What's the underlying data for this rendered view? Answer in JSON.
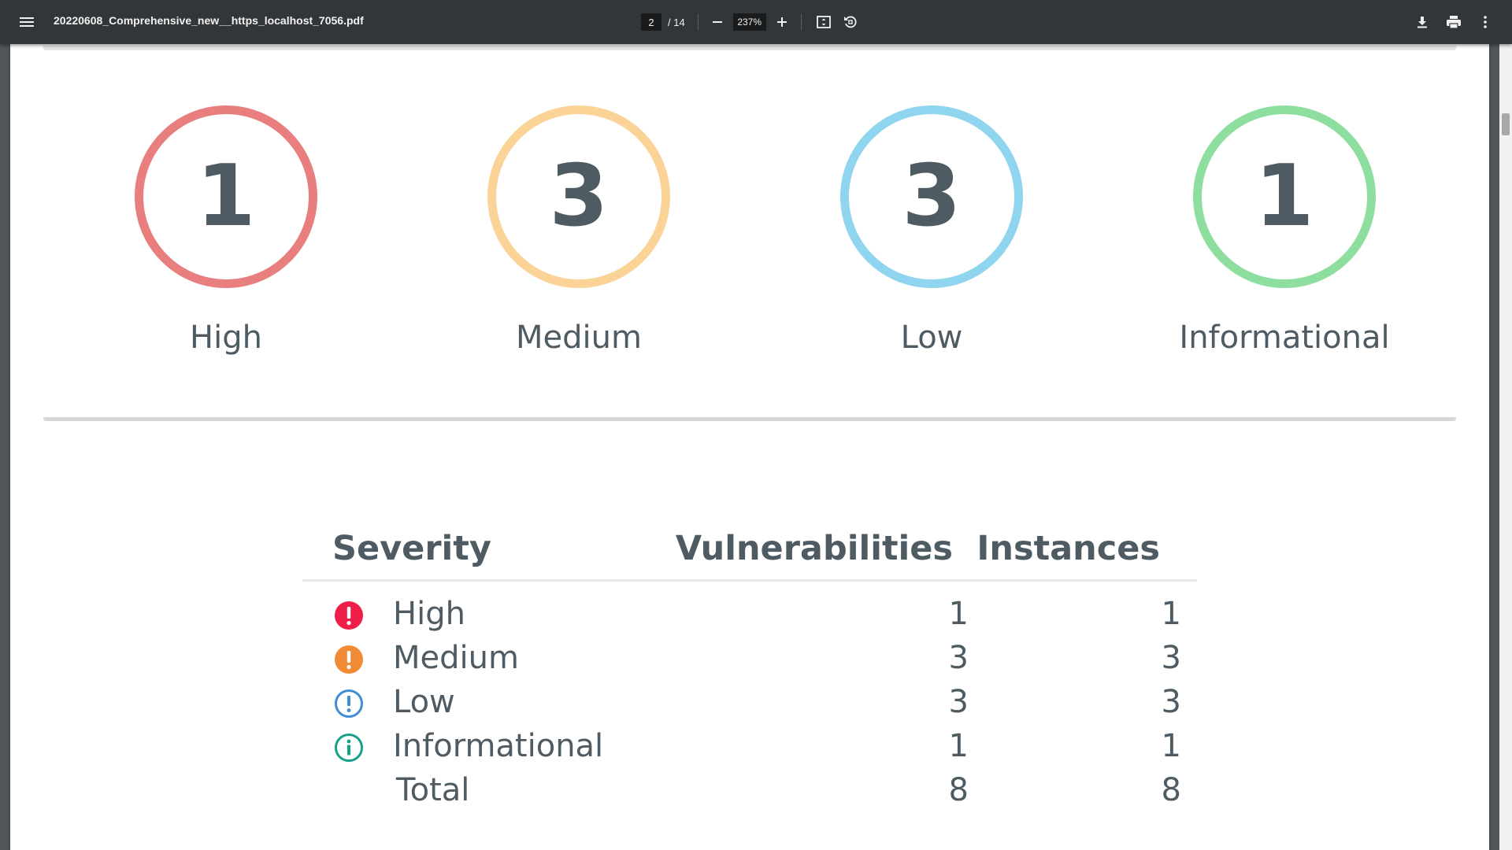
{
  "toolbar": {
    "filename": "20220608_Comprehensive_new__https_localhost_7056.pdf",
    "current_page": "2",
    "total_pages": "/ 14",
    "zoom": "237%",
    "icons": [
      "menu-icon",
      "zoom-out-icon",
      "zoom-in-icon",
      "fit-page-icon",
      "rotate-icon",
      "download-icon",
      "print-icon",
      "more-vert-icon"
    ]
  },
  "summary": [
    {
      "count": "1",
      "label": "High",
      "color": "#e97e7e"
    },
    {
      "count": "3",
      "label": "Medium",
      "color": "#fcd397"
    },
    {
      "count": "3",
      "label": "Low",
      "color": "#8fd5ef"
    },
    {
      "count": "1",
      "label": "Informational",
      "color": "#8edf9f"
    }
  ],
  "table": {
    "headers": {
      "severity": "Severity",
      "vulnerabilities": "Vulnerabilities",
      "instances": "Instances"
    },
    "rows": [
      {
        "label": "High",
        "vulnerabilities": "1",
        "instances": "1",
        "icon": "high-alert-icon",
        "icon_color": "#ee1e48"
      },
      {
        "label": "Medium",
        "vulnerabilities": "3",
        "instances": "3",
        "icon": "medium-alert-icon",
        "icon_color": "#f08a35"
      },
      {
        "label": "Low",
        "vulnerabilities": "3",
        "instances": "3",
        "icon": "low-alert-icon",
        "icon_color": "#3f8dd5"
      },
      {
        "label": "Informational",
        "vulnerabilities": "1",
        "instances": "1",
        "icon": "info-icon",
        "icon_color": "#18a18a"
      }
    ],
    "total": {
      "label": "Total",
      "vulnerabilities": "8",
      "instances": "8"
    }
  }
}
